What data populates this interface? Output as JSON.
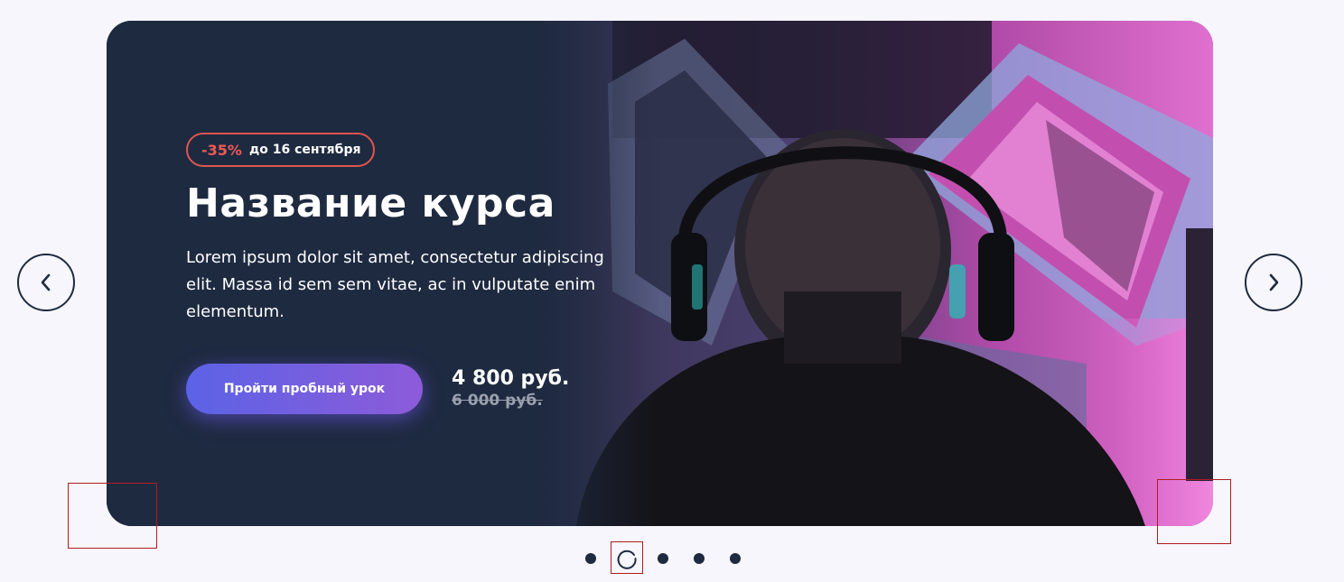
{
  "slide": {
    "badge": {
      "discount": "-35%",
      "until": "до 16 сентября"
    },
    "title": "Название курса",
    "description": "Lorem ipsum dolor sit amet, consectetur adipiscing elit. Massa id sem sem vitae, ac in vulputate enim elementum.",
    "cta_label": "Пройти пробный урок",
    "price_current": "4 800 руб.",
    "price_old": "6 000 руб."
  },
  "carousel": {
    "total_slides": 5,
    "active_index": 1
  },
  "icons": {
    "prev": "chevron-left-icon",
    "next": "chevron-right-icon",
    "loading": "spinner-icon"
  },
  "colors": {
    "page_bg": "#f6f6fc",
    "card_bg": "#1e2a40",
    "accent_red": "#f05a55",
    "button_gradient_start": "#5b63e6",
    "button_gradient_end": "#8d5bd9",
    "debug_box": "#b01d1d"
  }
}
